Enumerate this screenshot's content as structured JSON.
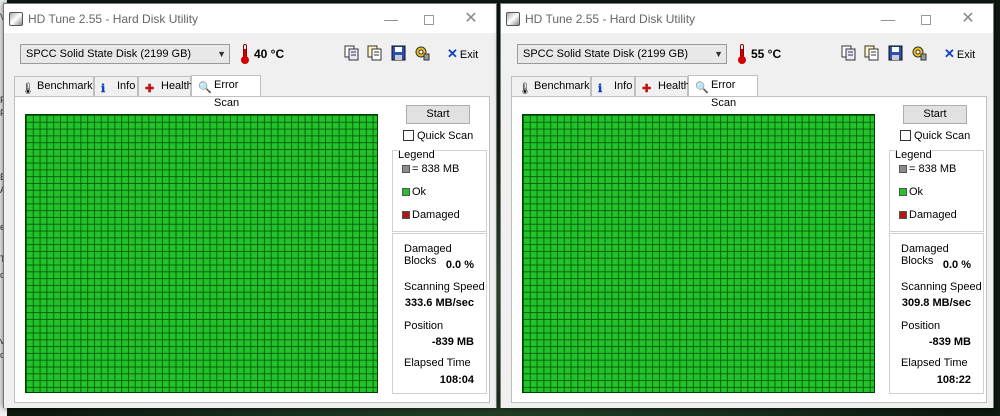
{
  "background": {
    "edge_fragments": [
      "V",
      "P",
      "Fr",
      "B",
      "A",
      "e",
      "T",
      "o",
      "ve",
      "o"
    ]
  },
  "colors": {
    "ok": "#22c22a",
    "damaged": "#b01818",
    "block": "#8c8c8c"
  },
  "windows": [
    {
      "title": "HD Tune 2.55 - Hard Disk Utility",
      "drive": "SPCC   Solid State Disk (2199 GB)",
      "temperature": "40 °C",
      "exit_label": "Exit",
      "tabs": [
        {
          "label": "Benchmark",
          "icon": "thermometer-icon"
        },
        {
          "label": "Info",
          "icon": "info-icon"
        },
        {
          "label": "Health",
          "icon": "health-cross-icon"
        },
        {
          "label": "Error Scan",
          "icon": "magnifier-icon",
          "active": true
        }
      ],
      "start_label": "Start",
      "quick_scan_label": "Quick Scan",
      "quick_scan_checked": false,
      "legend": {
        "title": "Legend",
        "block": "= 838 MB",
        "ok": "Ok",
        "damaged": "Damaged"
      },
      "stats": {
        "damaged_blocks_label": "Damaged Blocks",
        "damaged_blocks": "0.0 %",
        "scanning_speed_label": "Scanning Speed",
        "scanning_speed": "333.6 MB/sec",
        "position_label": "Position",
        "position": "-839 MB",
        "elapsed_label": "Elapsed Time",
        "elapsed": "108:04"
      }
    },
    {
      "title": "HD Tune 2.55 - Hard Disk Utility",
      "drive": "SPCC   Solid State Disk (2199 GB)",
      "temperature": "55 °C",
      "exit_label": "Exit",
      "tabs": [
        {
          "label": "Benchmark",
          "icon": "thermometer-icon"
        },
        {
          "label": "Info",
          "icon": "info-icon"
        },
        {
          "label": "Health",
          "icon": "health-cross-icon"
        },
        {
          "label": "Error Scan",
          "icon": "magnifier-icon",
          "active": true
        }
      ],
      "start_label": "Start",
      "quick_scan_label": "Quick Scan",
      "quick_scan_checked": false,
      "legend": {
        "title": "Legend",
        "block": "= 838 MB",
        "ok": "Ok",
        "damaged": "Damaged"
      },
      "stats": {
        "damaged_blocks_label": "Damaged Blocks",
        "damaged_blocks": "0.0 %",
        "scanning_speed_label": "Scanning Speed",
        "scanning_speed": "309.8 MB/sec",
        "position_label": "Position",
        "position": "-839 MB",
        "elapsed_label": "Elapsed Time",
        "elapsed": "108:22"
      }
    }
  ]
}
